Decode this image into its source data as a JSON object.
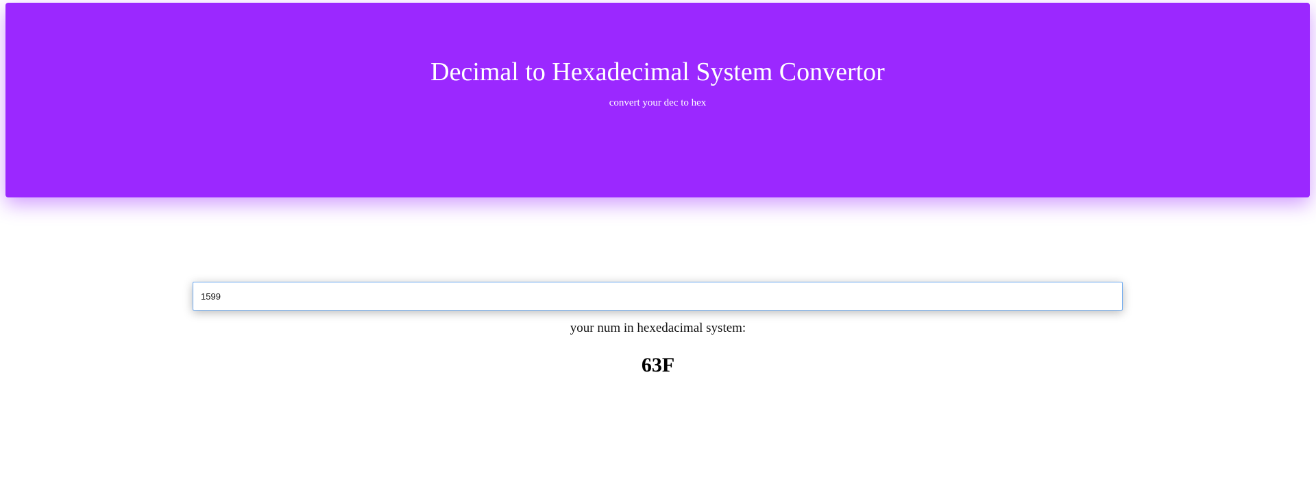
{
  "header": {
    "title": "Decimal to Hexadecimal System Convertor",
    "subtitle": "convert your dec to hex"
  },
  "converter": {
    "input_value": "1599",
    "result_label": "your num in hexedacimal system:",
    "result_value": "63F"
  },
  "colors": {
    "accent": "#9b28ff",
    "input_focus_border": "#6aa8f0",
    "text": "#111111"
  }
}
